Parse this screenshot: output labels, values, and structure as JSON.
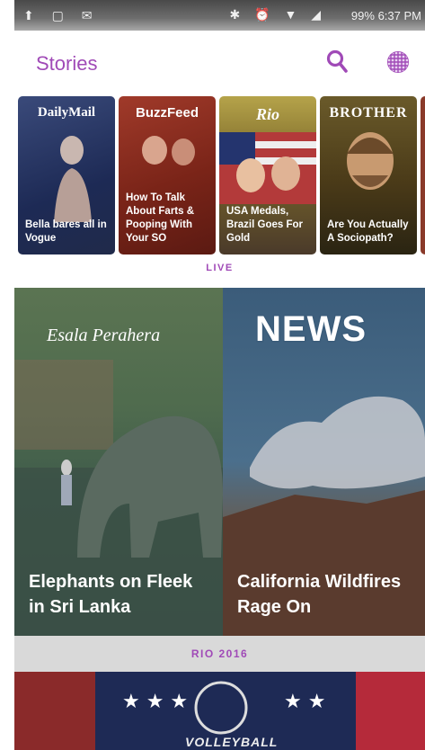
{
  "status_bar": {
    "time": "6:37 PM",
    "battery": "99%"
  },
  "header": {
    "title": "Stories"
  },
  "stories": [
    {
      "brand": "DailyMail",
      "caption": "Bella bares all in Vogue"
    },
    {
      "brand": "BuzzFeed",
      "caption": "How To Talk About Farts & Pooping With Your SO"
    },
    {
      "brand": "Rio",
      "caption": "USA Medals, Brazil Goes For Gold"
    },
    {
      "brand": "BROTHER",
      "caption": "Are You Actually A Sociopath?"
    }
  ],
  "live": {
    "label": "LIVE",
    "tiles": [
      {
        "title": "Elephants on Fleek in Sri Lanka",
        "badge": "Esala Perahera"
      },
      {
        "title": "California Wildfires Rage On",
        "badge": "NEWS"
      }
    ]
  },
  "rio": {
    "label": "RIO 2016",
    "banner_text": "VOLLEYBALL"
  },
  "colors": {
    "accent": "#a04ab7"
  }
}
